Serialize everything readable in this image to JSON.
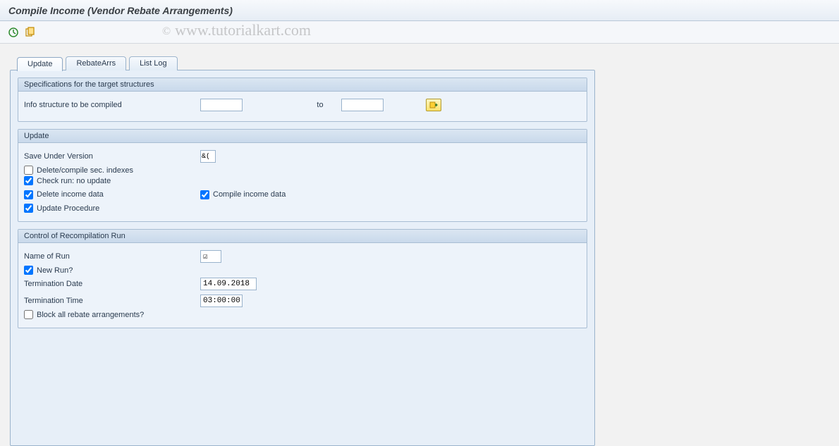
{
  "header": {
    "title": "Compile Income (Vendor Rebate Arrangements)"
  },
  "watermark": "www.tutorialkart.com",
  "tabs": [
    {
      "label": "Update",
      "active": true
    },
    {
      "label": "RebateArrs",
      "active": false
    },
    {
      "label": "List Log",
      "active": false
    }
  ],
  "section_specifications": {
    "title": "Specifications for the target structures",
    "info_structure_label": "Info structure to be compiled",
    "info_structure_from": "",
    "to_label": "to",
    "info_structure_to": ""
  },
  "section_update": {
    "title": "Update",
    "save_under_version_label": "Save Under Version",
    "save_under_version_value": "&(",
    "delete_compile_sec_indexes_label": "Delete/compile sec. indexes",
    "delete_compile_sec_indexes_checked": false,
    "check_run_label": "Check run: no update",
    "check_run_checked": true,
    "delete_income_label": "Delete income data",
    "delete_income_checked": true,
    "compile_income_label": "Compile income data",
    "compile_income_checked": true,
    "update_procedure_label": "Update Procedure",
    "update_procedure_checked": true
  },
  "section_control": {
    "title": "Control of Recompilation Run",
    "name_of_run_label": "Name of Run",
    "name_of_run_value": "☑",
    "new_run_label": "New Run?",
    "new_run_checked": true,
    "termination_date_label": "Termination Date",
    "termination_date_value": "14.09.2018",
    "termination_time_label": "Termination Time",
    "termination_time_value": "03:00:00",
    "block_all_label": "Block all rebate arrangements?",
    "block_all_checked": false
  }
}
